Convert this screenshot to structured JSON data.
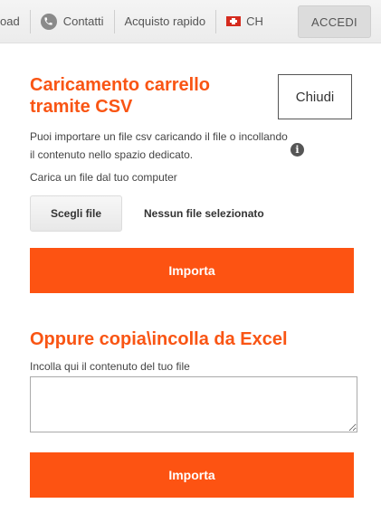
{
  "nav": {
    "items": [
      {
        "label": "oad"
      },
      {
        "label": "Contatti",
        "icon": "phone-icon"
      },
      {
        "label": "Acquisto rapido"
      },
      {
        "label": "CH",
        "icon": "swiss-flag-icon"
      }
    ],
    "login_label": "ACCEDI"
  },
  "csv": {
    "title": "Caricamento carrello tramite CSV",
    "close_label": "Chiudi",
    "description": "Puoi importare un file csv caricando il file o incollando il contenuto nello spazio dedicato.",
    "upload_label": "Carica un file dal tuo computer",
    "file_button": "Scegli file",
    "file_status": "Nessun file selezionato",
    "import_label": "Importa"
  },
  "paste": {
    "title": "Oppure copia\\incolla da Excel",
    "label": "Incolla qui il contenuto del tuo file",
    "value": "",
    "import_label": "Importa"
  },
  "colors": {
    "accent": "#fd5312",
    "title": "#f95514"
  }
}
